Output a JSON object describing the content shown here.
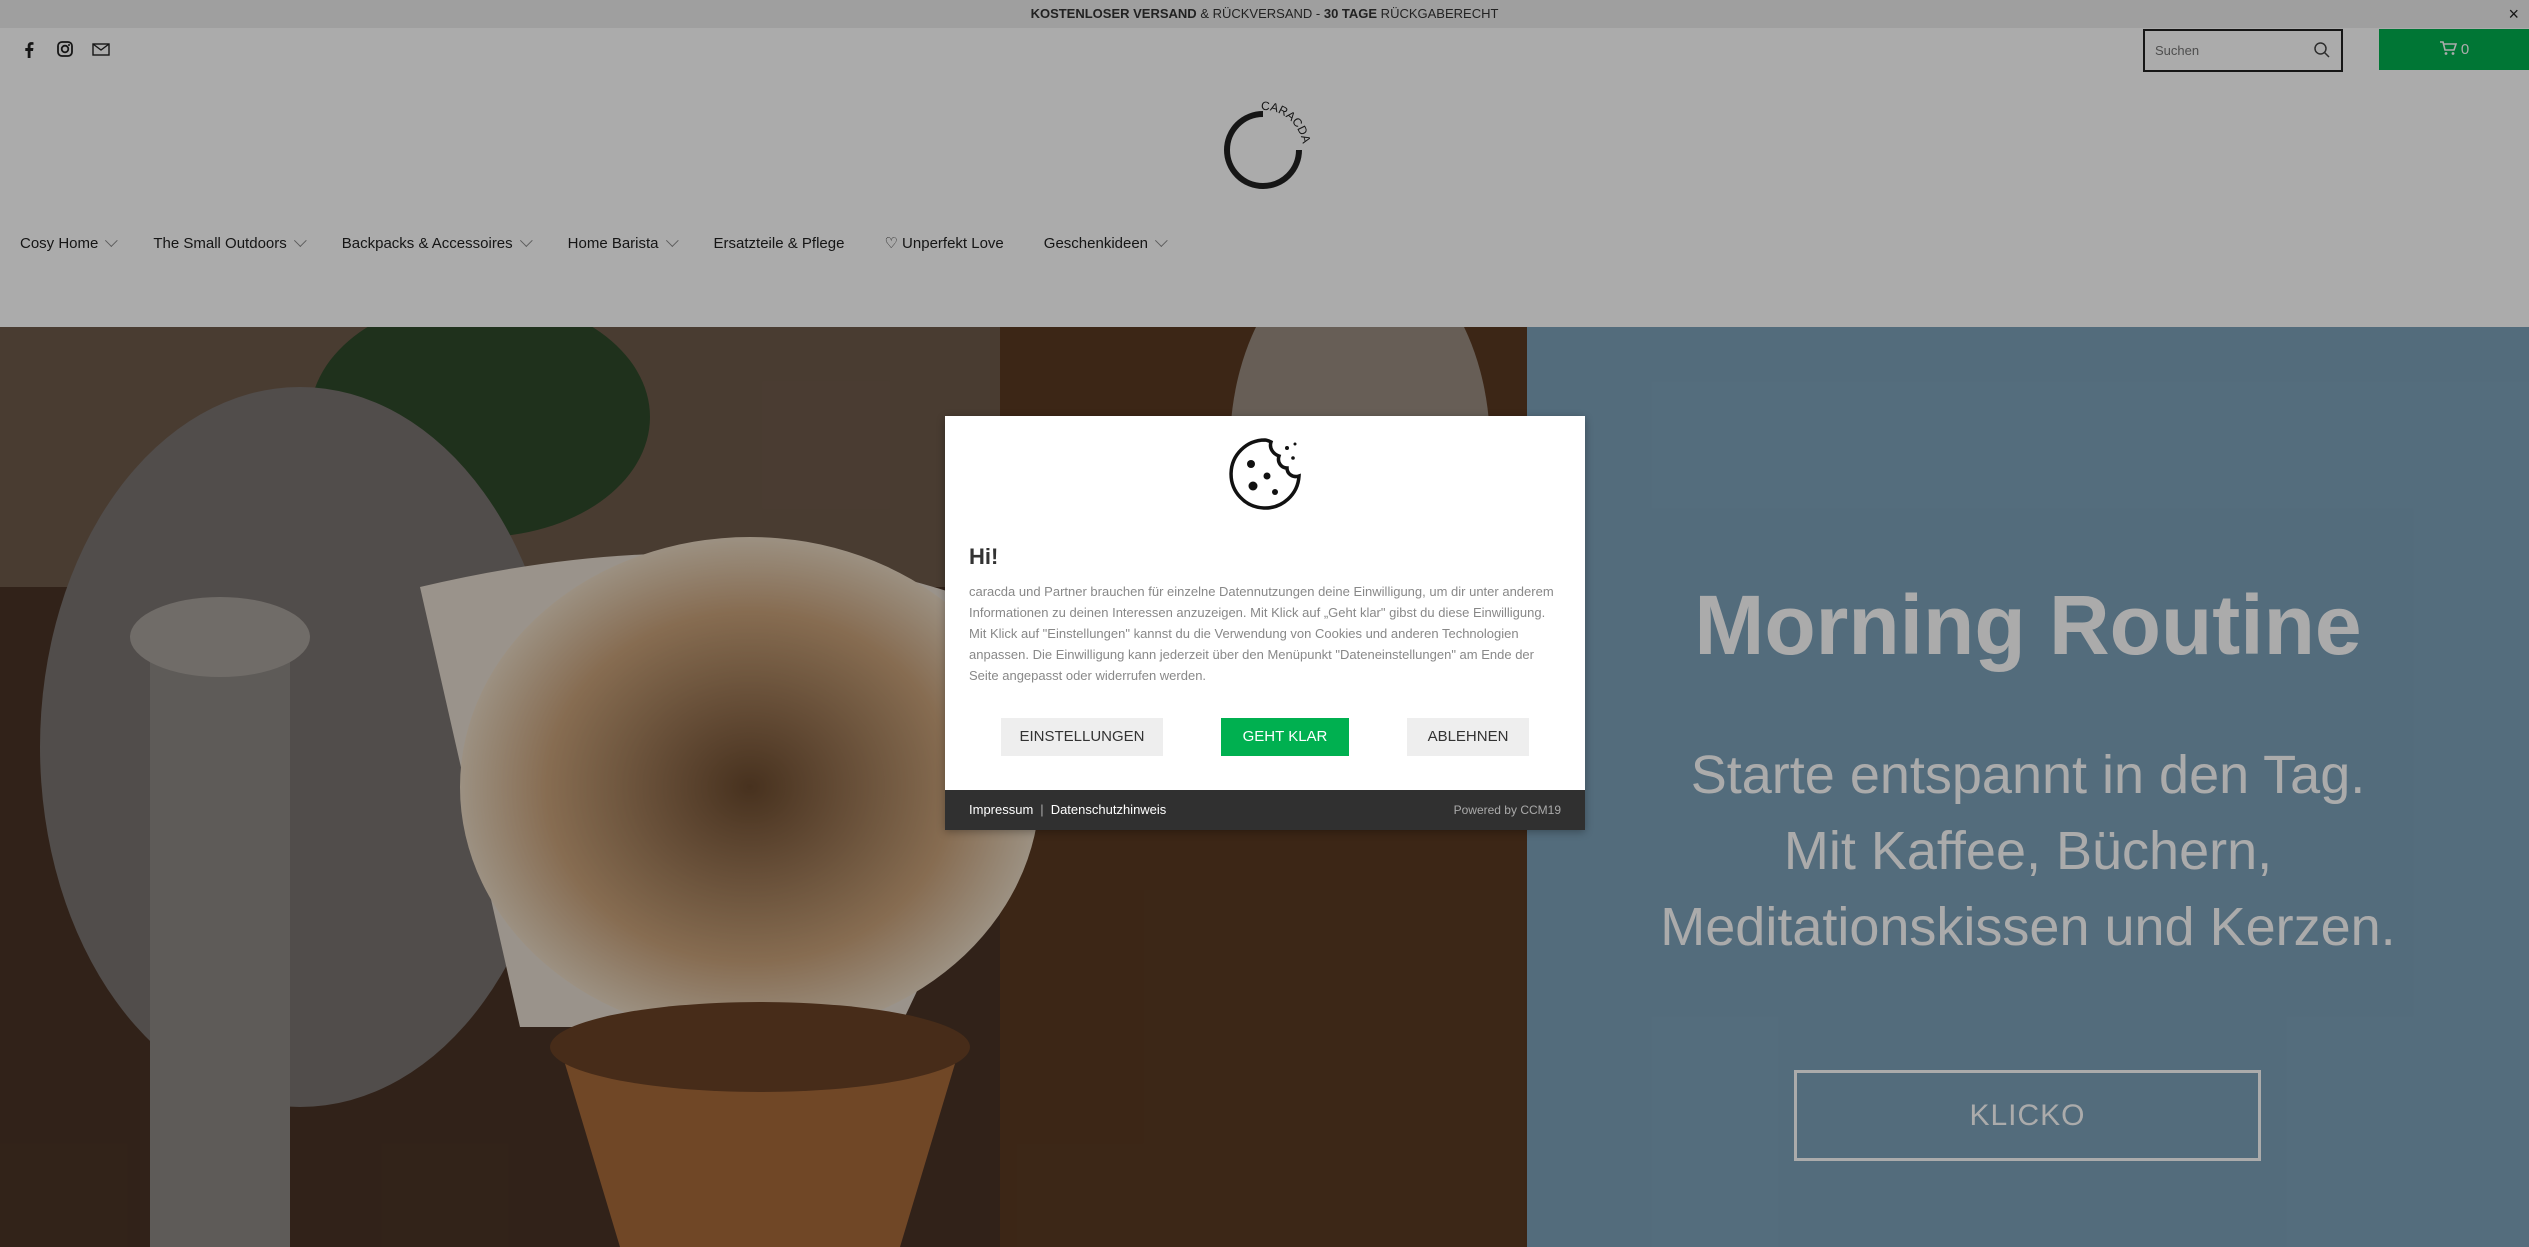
{
  "announcement": {
    "bold1": "KOSTENLOSER VERSAND",
    "text1": " & RÜCKVERSAND - ",
    "bold2": "30 TAGE",
    "text2": " RÜCKGABERECHT",
    "close": "×"
  },
  "header": {
    "search_placeholder": "Suchen",
    "cart_count": "0",
    "logo_text": "CARACDA"
  },
  "nav": [
    {
      "label": "Cosy Home",
      "has_dropdown": true
    },
    {
      "label": "The Small Outdoors",
      "has_dropdown": true
    },
    {
      "label": "Backpacks & Accessoires",
      "has_dropdown": true
    },
    {
      "label": "Home Barista",
      "has_dropdown": true
    },
    {
      "label": "Ersatzteile & Pflege",
      "has_dropdown": false
    },
    {
      "label": "♡ Unperfekt Love",
      "has_dropdown": false
    },
    {
      "label": "Geschenkideen",
      "has_dropdown": true
    }
  ],
  "hero": {
    "title": "Morning Routine",
    "subtitle_line1": "Starte entspannt in den Tag.",
    "subtitle_line2": "Mit Kaffee, Büchern,",
    "subtitle_line3": "Meditationskissen und Kerzen.",
    "button": "KLICKO"
  },
  "cookie_dialog": {
    "title": "Hi!",
    "text": "caracda und Partner brauchen für einzelne Datennutzungen deine Einwilligung, um dir unter anderem Informationen zu deinen Interessen anzuzeigen. Mit Klick auf „Geht klar\" gibst du diese Einwilligung. Mit Klick auf \"Einstellungen\" kannst du die Verwendung von Cookies und anderen Technologien anpassen. Die Einwilligung kann jederzeit über den Menüpunkt \"Dateneinstellungen\" am Ende der Seite angepasst oder widerrufen werden.",
    "btn_settings": "EINSTELLUNGEN",
    "btn_accept": "GEHT KLAR",
    "btn_decline": "ABLEHNEN",
    "footer_impressum": "Impressum",
    "footer_datenschutz": "Datenschutzhinweis",
    "footer_powered": "Powered by CCM19"
  },
  "colors": {
    "accent_green": "#00b050",
    "hero_panel": "#7da2ba",
    "dialog_footer": "#303030"
  },
  "icons": [
    "facebook-icon",
    "instagram-icon",
    "mail-icon",
    "search-icon",
    "cart-icon",
    "cookie-icon",
    "chevron-down-icon"
  ]
}
